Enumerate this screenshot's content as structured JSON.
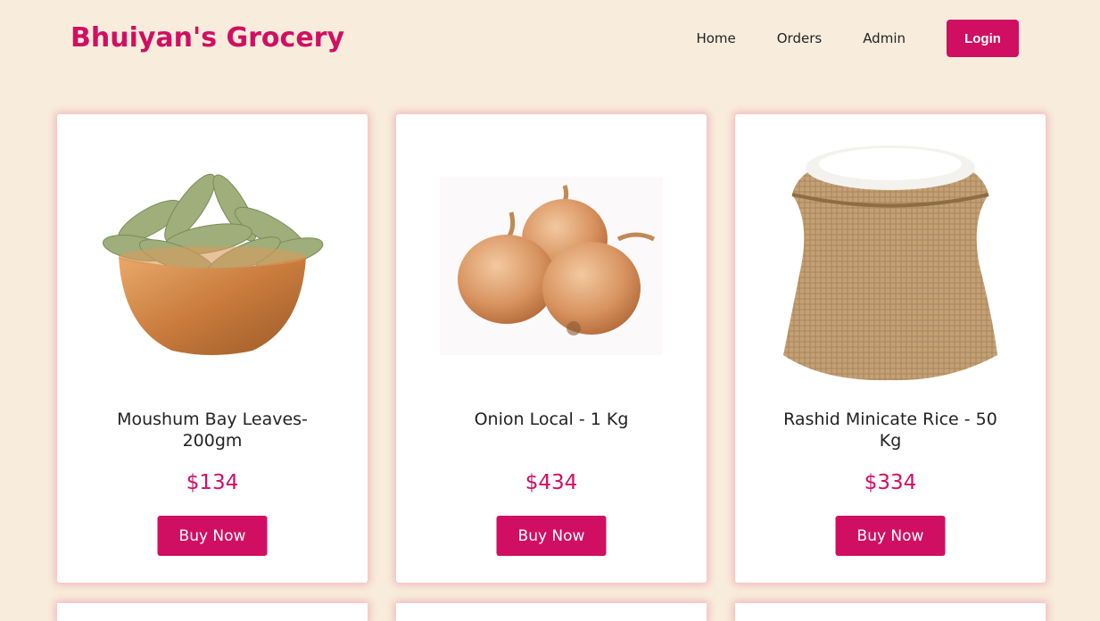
{
  "header": {
    "brand": "Bhuiyan's Grocery",
    "nav": [
      "Home",
      "Orders",
      "Admin"
    ],
    "login_label": "Login"
  },
  "products": [
    {
      "name": "Moushum Bay Leaves-200gm",
      "price": "$134",
      "button": "Buy Now",
      "image": "bay-leaves-bowl"
    },
    {
      "name": "Onion Local - 1 Kg",
      "price": "$434",
      "button": "Buy Now",
      "image": "onions"
    },
    {
      "name": "Rashid Minicate Rice - 50 Kg",
      "price": "$334",
      "button": "Buy Now",
      "image": "rice-sack"
    }
  ],
  "colors": {
    "accent": "#d10f62",
    "background": "#f8eddc"
  }
}
